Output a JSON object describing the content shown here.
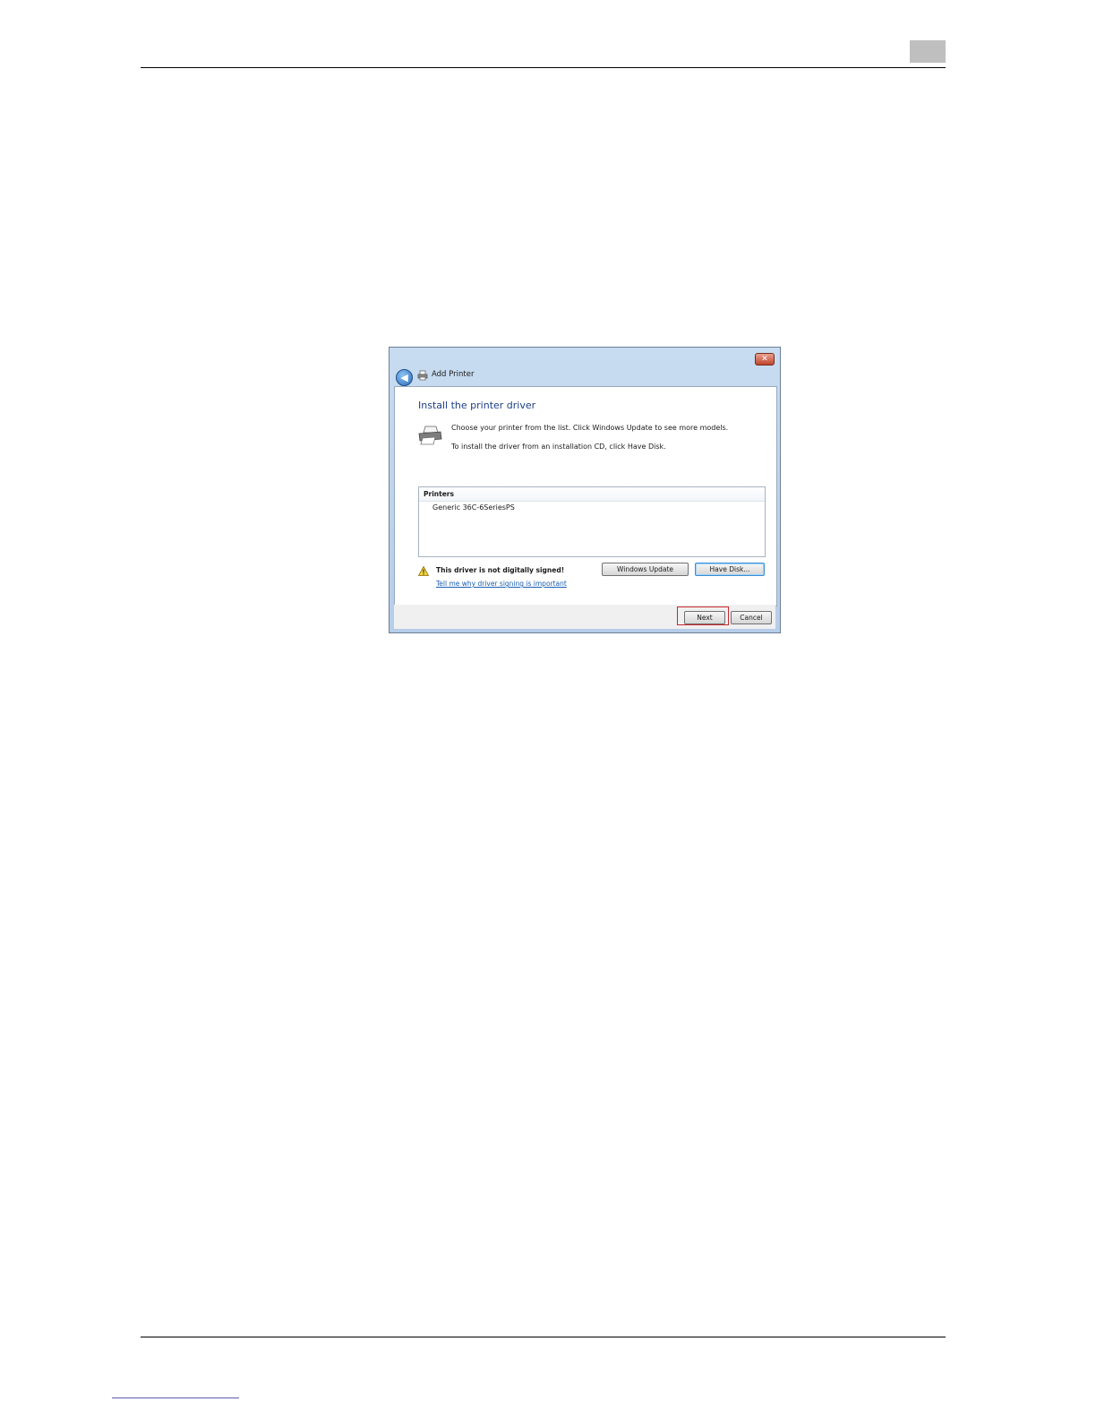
{
  "dialog": {
    "title": "Add Printer",
    "heading": "Install the printer driver",
    "instruction_line1": "Choose your printer from the list. Click Windows Update to see more models.",
    "instruction_line2": "To install the driver from an installation CD, click Have Disk.",
    "printers_header": "Printers",
    "printers": [
      "Generic 36C-6SeriesPS"
    ],
    "warning_text": "This driver is not digitally signed!",
    "warning_link": "Tell me why driver signing is important",
    "buttons": {
      "windows_update": "Windows Update",
      "have_disk": "Have Disk...",
      "next": "Next",
      "cancel": "Cancel"
    }
  },
  "colors": {
    "heading_blue": "#1e3e86",
    "link_blue": "#1a5fb4",
    "highlight_red": "#c8262e"
  }
}
